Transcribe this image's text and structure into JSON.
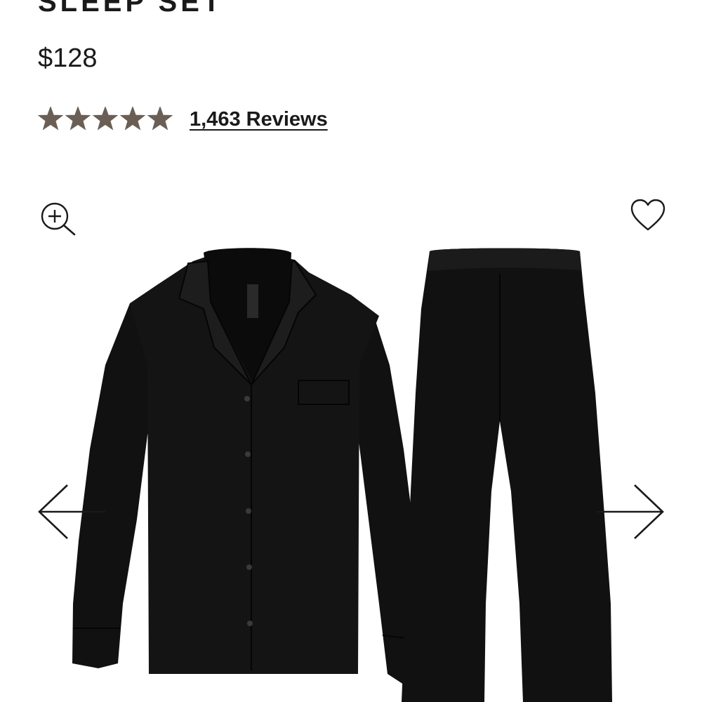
{
  "product": {
    "title": "SLEEP SET",
    "price": "$128"
  },
  "rating": {
    "stars": 5,
    "max_stars": 5,
    "star_color": "#6b5f55",
    "reviews_label": "1,463 Reviews"
  },
  "icons": {
    "zoom": "zoom-in-icon",
    "favorite": "heart-outline-icon",
    "previous": "arrow-left-icon",
    "next": "arrow-right-icon"
  },
  "gallery": {
    "image_alt": "Black long-sleeve button-up pajama shirt and wide-leg pants"
  }
}
